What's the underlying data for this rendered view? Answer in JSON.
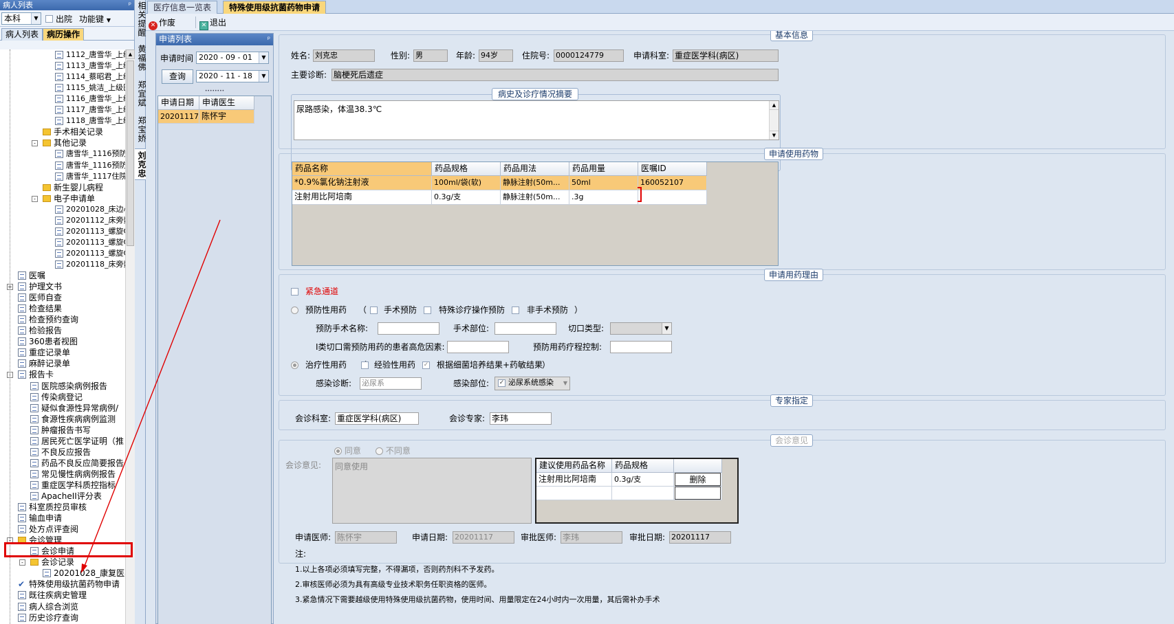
{
  "left_panel": {
    "title": "病人列表",
    "pin": "ᵖ",
    "dept_combo": "本科",
    "discharged_label": "出院",
    "function_key_label": "功能键",
    "tabs": [
      "病人列表",
      "病历操作"
    ],
    "tree": [
      {
        "text": "1112_唐雪华_上级",
        "indent": 4,
        "icon": "doc"
      },
      {
        "text": "1113_唐雪华_上级",
        "indent": 4,
        "icon": "doc"
      },
      {
        "text": "1114_蔡昭君_上级",
        "indent": 4,
        "icon": "doc"
      },
      {
        "text": "1115_姚洁_上级医",
        "indent": 4,
        "icon": "doc"
      },
      {
        "text": "1116_唐雪华_上级",
        "indent": 4,
        "icon": "doc"
      },
      {
        "text": "1117_唐雪华_上级",
        "indent": 4,
        "icon": "doc"
      },
      {
        "text": "1118_唐雪华_上级",
        "indent": 4,
        "icon": "doc"
      },
      {
        "text": "手术相关记录",
        "indent": 3,
        "icon": "folder"
      },
      {
        "text": "其他记录",
        "indent": 3,
        "icon": "folder",
        "expand": "-"
      },
      {
        "text": "唐雪华_1116预防",
        "indent": 4,
        "icon": "doc"
      },
      {
        "text": "唐雪华_1116预防",
        "indent": 4,
        "icon": "doc"
      },
      {
        "text": "唐雪华_1117住院",
        "indent": 4,
        "icon": "doc"
      },
      {
        "text": "新生婴儿病程",
        "indent": 3,
        "icon": "folder"
      },
      {
        "text": "电子申请单",
        "indent": 3,
        "icon": "folder",
        "expand": "-"
      },
      {
        "text": "20201028_床边心电",
        "indent": 4,
        "icon": "doc"
      },
      {
        "text": "20201112_床旁数字",
        "indent": 4,
        "icon": "doc"
      },
      {
        "text": "20201113_螺旋CT",
        "indent": 4,
        "icon": "doc"
      },
      {
        "text": "20201113_螺旋CT",
        "indent": 4,
        "icon": "doc"
      },
      {
        "text": "20201113_螺旋CT",
        "indent": 4,
        "icon": "doc"
      },
      {
        "text": "20201118_床旁数字",
        "indent": 4,
        "icon": "doc"
      },
      {
        "text": "医嘱",
        "indent": 1,
        "icon": "doc"
      },
      {
        "text": "护理文书",
        "indent": 1,
        "icon": "doc",
        "expand": "+"
      },
      {
        "text": "医师自查",
        "indent": 1,
        "icon": "doc"
      },
      {
        "text": "检查结果",
        "indent": 1,
        "icon": "doc"
      },
      {
        "text": "检查预约查询",
        "indent": 1,
        "icon": "doc"
      },
      {
        "text": "检验报告",
        "indent": 1,
        "icon": "doc"
      },
      {
        "text": "360患者视图",
        "indent": 1,
        "icon": "doc"
      },
      {
        "text": "重症记录单",
        "indent": 1,
        "icon": "doc"
      },
      {
        "text": "麻醉记录单",
        "indent": 1,
        "icon": "doc"
      },
      {
        "text": "报告卡",
        "indent": 1,
        "icon": "doc",
        "expand": "-"
      },
      {
        "text": "医院感染病例报告",
        "indent": 2,
        "icon": "doc"
      },
      {
        "text": "传染病登记",
        "indent": 2,
        "icon": "doc"
      },
      {
        "text": "疑似食源性异常病例/",
        "indent": 2,
        "icon": "doc"
      },
      {
        "text": "食源性疾病病例监测",
        "indent": 2,
        "icon": "doc"
      },
      {
        "text": "肿瘤报告书写",
        "indent": 2,
        "icon": "doc"
      },
      {
        "text": "居民死亡医学证明（推",
        "indent": 2,
        "icon": "doc"
      },
      {
        "text": "不良反应报告",
        "indent": 2,
        "icon": "doc"
      },
      {
        "text": "药品不良反应简要报告",
        "indent": 2,
        "icon": "doc"
      },
      {
        "text": "常见慢性病病例报告",
        "indent": 2,
        "icon": "doc"
      },
      {
        "text": "重症医学科质控指标",
        "indent": 2,
        "icon": "doc"
      },
      {
        "text": "ApacheII评分表",
        "indent": 2,
        "icon": "doc"
      },
      {
        "text": "科室质控员审核",
        "indent": 1,
        "icon": "doc"
      },
      {
        "text": "输血申请",
        "indent": 1,
        "icon": "doc"
      },
      {
        "text": "处方点评查阅",
        "indent": 1,
        "icon": "doc"
      },
      {
        "text": "会诊管理",
        "indent": 1,
        "icon": "folder",
        "expand": "-"
      },
      {
        "text": "会诊申请",
        "indent": 2,
        "icon": "doc"
      },
      {
        "text": "会诊记录",
        "indent": 2,
        "icon": "folder",
        "expand": "-"
      },
      {
        "text": "20201028_康复医学",
        "indent": 3,
        "icon": "doc"
      },
      {
        "text": "特殊使用级抗菌药物申请",
        "indent": 1,
        "icon": "check"
      },
      {
        "text": "既往疾病史管理",
        "indent": 1,
        "icon": "doc"
      },
      {
        "text": "病人综合浏览",
        "indent": 1,
        "icon": "doc"
      },
      {
        "text": "历史诊疗查询",
        "indent": 1,
        "icon": "doc"
      }
    ]
  },
  "vertical_tabs": [
    "相关提醒",
    "黄福佛",
    "郑宜斌",
    "郑宝娇",
    "刘克忠"
  ],
  "top_tabs": [
    "医疗信息一览表",
    "特殊使用级抗菌药物申请"
  ],
  "toolbar": {
    "void": "作废",
    "exit": "退出"
  },
  "apply_list": {
    "title": "申请列表",
    "pin": "ᵖ",
    "time_label": "申请时间",
    "date_from": "2020 - 09 - 01",
    "query_button": "查询",
    "date_to": "2020 - 11 - 18",
    "grip": "••••••••",
    "columns": [
      "申请日期",
      "申请医生"
    ],
    "rows": [
      [
        "20201117",
        "陈怀宇"
      ]
    ]
  },
  "basic_info": {
    "section_title": "基本信息",
    "name_label": "姓名:",
    "name": "刘克忠",
    "sex_label": "性别:",
    "sex": "男",
    "age_label": "年龄:",
    "age": "94岁",
    "inpatient_label": "住院号:",
    "inpatient_no": "0000124779",
    "dept_label": "申请科室:",
    "dept": "重症医学科(病区)",
    "diagnosis_label": "主要诊断:",
    "diagnosis": "脑梗死后遗症",
    "history_title": "病史及诊疗情况摘要",
    "history_text": "尿路感染，体温38.3℃"
  },
  "drugs": {
    "section_title": "申请使用药物",
    "columns": [
      "药品名称",
      "药品规格",
      "药品用法",
      "药品用量",
      "医嘱ID"
    ],
    "rows": [
      [
        "*0.9%氯化钠注射液",
        "100ml/袋(软)",
        "静脉注射(50m...",
        "50ml",
        "160052107"
      ],
      [
        "注射用比阿培南",
        "0.3g/支",
        "静脉注射(50m...",
        ".3g",
        ""
      ]
    ]
  },
  "reason": {
    "section_title": "申请用药理由",
    "emergency": "紧急通道",
    "prevention": "预防性用药",
    "paren_open": "（",
    "paren_close": "）",
    "surgical_prevention": "手术预防",
    "special_op_prevention": "特殊诊疗操作预防",
    "non_surgical_prevention": "非手术预防",
    "surgery_name_label": "预防手术名称:",
    "surgery_site_label": "手术部位:",
    "incision_type_label": "切口类型:",
    "risk_label": "I类切口需预防用药的患者高危因素:",
    "course_label": "预防用药疗程控制:",
    "treatment": "治疗性用药",
    "empirical": "经验性用药",
    "culture_based": "根据细菌培养结果+药敏结果",
    "infection_dx_label": "感染诊断:",
    "infection_dx": "泌尿系",
    "infection_site_label": "感染部位:",
    "infection_site": "泌尿系统感染"
  },
  "expert": {
    "section_title": "专家指定",
    "dept_label": "会诊科室:",
    "dept": "重症医学科(病区)",
    "expert_label": "会诊专家:",
    "expert": "李玮"
  },
  "opinion": {
    "section_title": "会诊意见",
    "agree": "同意",
    "disagree": "不同意",
    "opinion_label": "会诊意见:",
    "opinion_text": "同意使用",
    "columns": [
      "建议使用药品名称",
      "药品规格",
      ""
    ],
    "rows": [
      [
        "注射用比阿培南",
        "0.3g/支",
        "删除"
      ]
    ]
  },
  "footer": {
    "apply_doctor_label": "申请医师:",
    "apply_doctor": "陈怀宇",
    "apply_date_label": "申请日期:",
    "apply_date": "20201117",
    "approve_doctor_label": "审批医师:",
    "approve_doctor": "李玮",
    "approve_date_label": "审批日期:",
    "approve_date": "20201117",
    "note_label": "注:",
    "notes": [
      "1.以上各项必须填写完整，不得漏项，否则药剂科不予发药。",
      "2.审核医师必须为具有高级专业技术职务任职资格的医师。",
      "3.紧急情况下需要越级使用特殊使用级抗菌药物，使用时间、用量限定在24小时内一次用量，其后需补办手术"
    ]
  },
  "colors": {
    "highlight_row": "#f8c978",
    "annotation_red": "#e00000",
    "header_blue": "#3c69ad"
  }
}
